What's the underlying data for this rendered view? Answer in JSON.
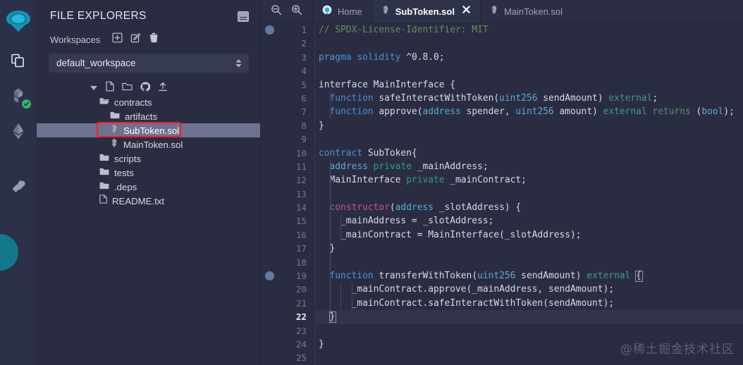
{
  "iconbar": {
    "items": [
      {
        "name": "remix-logo",
        "title": "Remix"
      },
      {
        "name": "file-explorer-icon",
        "title": "File explorers"
      },
      {
        "name": "solidity-compiler-icon",
        "title": "Solidity compiler"
      },
      {
        "name": "deploy-run-icon",
        "title": "Deploy & run transactions"
      },
      {
        "name": "plugin-manager-icon",
        "title": "Plugin manager"
      }
    ]
  },
  "explorer": {
    "title": "FILE EXPLORERS",
    "panel_toggle": "panel-toggle",
    "workspaces_label": "Workspaces",
    "workspace_actions": [
      "create-workspace",
      "rename-workspace",
      "delete-workspace"
    ],
    "workspace_value": "default_workspace",
    "tree": [
      {
        "label": "contracts",
        "type": "folder-open",
        "indent": 1
      },
      {
        "label": "artifacts",
        "type": "folder",
        "indent": 2
      },
      {
        "label": "SubToken.sol",
        "type": "solidity",
        "indent": 2,
        "selected": true
      },
      {
        "label": "MainToken.sol",
        "type": "solidity",
        "indent": 2
      },
      {
        "label": "scripts",
        "type": "folder",
        "indent": 1
      },
      {
        "label": "tests",
        "type": "folder",
        "indent": 1
      },
      {
        "label": ".deps",
        "type": "folder",
        "indent": 1
      },
      {
        "label": "README.txt",
        "type": "file",
        "indent": 1
      }
    ],
    "annotation_color": "#fc1b20",
    "annotated_item": "SubToken.sol"
  },
  "editor": {
    "zoom_out": "zoom-out",
    "zoom_in": "zoom-in",
    "tabs": [
      {
        "label": "Home",
        "icon": "remix-home-icon",
        "active": false,
        "closable": false
      },
      {
        "label": "SubToken.sol",
        "icon": "solidity-icon",
        "active": true,
        "closable": true
      },
      {
        "label": "MainToken.sol",
        "icon": "solidity-icon",
        "active": false,
        "closable": false
      }
    ],
    "current_line": 22,
    "breakpoint_lines": [
      1,
      19
    ],
    "total_lines": 25,
    "lines": [
      {
        "n": 1,
        "tokens": [
          {
            "t": "// SPDX-License-Identifier: MIT",
            "c": "t-com"
          }
        ]
      },
      {
        "n": 2,
        "tokens": []
      },
      {
        "n": 3,
        "tokens": [
          {
            "t": "pragma",
            "c": "t-key"
          },
          {
            "t": " ",
            "c": "t-pun"
          },
          {
            "t": "solidity",
            "c": "t-key"
          },
          {
            "t": " ^0.8.0;",
            "c": "t-num"
          }
        ]
      },
      {
        "n": 4,
        "tokens": []
      },
      {
        "n": 5,
        "tokens": [
          {
            "t": "interface",
            "c": "t-id"
          },
          {
            "t": " MainInterface {",
            "c": "t-id"
          }
        ]
      },
      {
        "n": 6,
        "tokens": [
          {
            "t": "  ",
            "c": "t-pun"
          },
          {
            "t": "function",
            "c": "t-key"
          },
          {
            "t": " safeInteractWithToken(",
            "c": "t-id"
          },
          {
            "t": "uint256",
            "c": "t-typ"
          },
          {
            "t": " sendAmount) ",
            "c": "t-id"
          },
          {
            "t": "external",
            "c": "t-mod"
          },
          {
            "t": ";",
            "c": "t-pun"
          }
        ]
      },
      {
        "n": 7,
        "tokens": [
          {
            "t": "  ",
            "c": "t-pun"
          },
          {
            "t": "function",
            "c": "t-key"
          },
          {
            "t": " approve(",
            "c": "t-id"
          },
          {
            "t": "address",
            "c": "t-typ"
          },
          {
            "t": " spender, ",
            "c": "t-id"
          },
          {
            "t": "uint256",
            "c": "t-typ"
          },
          {
            "t": " amount) ",
            "c": "t-id"
          },
          {
            "t": "external",
            "c": "t-mod"
          },
          {
            "t": " ",
            "c": "t-pun"
          },
          {
            "t": "returns",
            "c": "t-ret"
          },
          {
            "t": " (",
            "c": "t-id"
          },
          {
            "t": "bool",
            "c": "t-typ"
          },
          {
            "t": ");",
            "c": "t-id"
          }
        ]
      },
      {
        "n": 8,
        "tokens": [
          {
            "t": "}",
            "c": "t-pun"
          }
        ]
      },
      {
        "n": 9,
        "tokens": []
      },
      {
        "n": 10,
        "tokens": [
          {
            "t": "contract",
            "c": "t-key"
          },
          {
            "t": " SubToken{",
            "c": "t-id"
          }
        ]
      },
      {
        "n": 11,
        "tokens": [
          {
            "t": "  ",
            "c": "t-pun"
          },
          {
            "t": "address",
            "c": "t-typ"
          },
          {
            "t": " ",
            "c": "t-pun"
          },
          {
            "t": "private",
            "c": "t-priv"
          },
          {
            "t": " _mainAddress;",
            "c": "t-id"
          }
        ]
      },
      {
        "n": 12,
        "tokens": [
          {
            "t": "  MainInterface ",
            "c": "t-id"
          },
          {
            "t": "private",
            "c": "t-priv"
          },
          {
            "t": " _mainContract;",
            "c": "t-id"
          }
        ]
      },
      {
        "n": 13,
        "tokens": []
      },
      {
        "n": 14,
        "tokens": [
          {
            "t": "  ",
            "c": "t-pun"
          },
          {
            "t": "constructor",
            "c": "t-ctor"
          },
          {
            "t": "(",
            "c": "t-id"
          },
          {
            "t": "address",
            "c": "t-typ"
          },
          {
            "t": " _slotAddress) {",
            "c": "t-id"
          }
        ]
      },
      {
        "n": 15,
        "tokens": [
          {
            "t": "    _mainAddress = _slotAddress;",
            "c": "t-id"
          }
        ]
      },
      {
        "n": 16,
        "tokens": [
          {
            "t": "    _mainContract = MainInterface(_slotAddress);",
            "c": "t-id"
          }
        ]
      },
      {
        "n": 17,
        "tokens": [
          {
            "t": "  }",
            "c": "t-pun"
          }
        ]
      },
      {
        "n": 18,
        "tokens": []
      },
      {
        "n": 19,
        "tokens": [
          {
            "t": "  ",
            "c": "t-pun"
          },
          {
            "t": "function",
            "c": "t-key"
          },
          {
            "t": " transferWithToken(",
            "c": "t-id"
          },
          {
            "t": "uint256",
            "c": "t-typ"
          },
          {
            "t": " sendAmount) ",
            "c": "t-id"
          },
          {
            "t": "external",
            "c": "t-mod"
          },
          {
            "t": " {",
            "c": "t-id"
          }
        ]
      },
      {
        "n": 20,
        "tokens": [
          {
            "t": "      _mainContract.approve(_mainAddress, sendAmount);",
            "c": "t-id"
          }
        ]
      },
      {
        "n": 21,
        "tokens": [
          {
            "t": "      _mainContract.safeInteractWithToken(sendAmount);",
            "c": "t-id"
          }
        ]
      },
      {
        "n": 22,
        "tokens": [
          {
            "t": "  }",
            "c": "t-pun"
          }
        ]
      },
      {
        "n": 23,
        "tokens": []
      },
      {
        "n": 24,
        "tokens": [
          {
            "t": "}",
            "c": "t-pun"
          }
        ]
      },
      {
        "n": 25,
        "tokens": []
      }
    ]
  },
  "watermark": "@稀土掘金技术社区"
}
